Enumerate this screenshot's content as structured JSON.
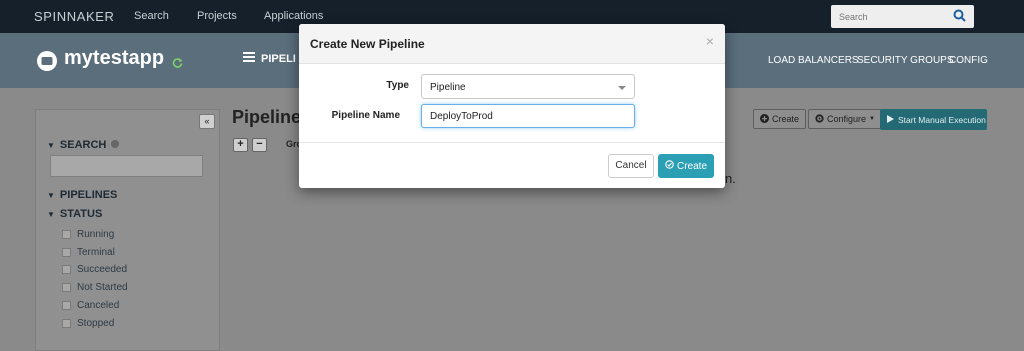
{
  "topnav": {
    "brand": "SPINNAKER",
    "links": [
      "Search",
      "Projects",
      "Applications"
    ],
    "search_placeholder": "Search"
  },
  "app": {
    "name": "mytestapp",
    "active_tab": "PIPELI",
    "right_nav": [
      "LOAD BALANCERS",
      "SECURITY GROUPS",
      "CONFIG"
    ]
  },
  "sidebar": {
    "collapse_glyph": "«",
    "search_label": "SEARCH",
    "pipelines_label": "PIPELINES",
    "status_label": "STATUS",
    "statuses": [
      "Running",
      "Terminal",
      "Succeeded",
      "Not Started",
      "Canceled",
      "Stopped"
    ]
  },
  "main": {
    "title": "Pipelines",
    "plus": "+",
    "minus": "−",
    "group_label": "Gro",
    "trailing_text": "n."
  },
  "toolbar": {
    "create_label": "Create",
    "configure_label": "Configure",
    "start_label": "Start Manual Execution"
  },
  "modal": {
    "title": "Create New Pipeline",
    "close_glyph": "×",
    "type_label": "Type",
    "type_value": "Pipeline",
    "name_label": "Pipeline Name",
    "name_value": "DeployToProd",
    "cancel_label": "Cancel",
    "create_label": "Create"
  },
  "colors": {
    "accent": "#2ba0b5",
    "nav_bg": "#15202b"
  },
  "icons": [
    "search-icon",
    "app-icon",
    "refresh-icon",
    "pipelines-icon",
    "help-icon",
    "chevron-down-icon",
    "plus-circle-icon",
    "gear-icon",
    "play-icon",
    "check-circle-icon",
    "close-icon"
  ]
}
